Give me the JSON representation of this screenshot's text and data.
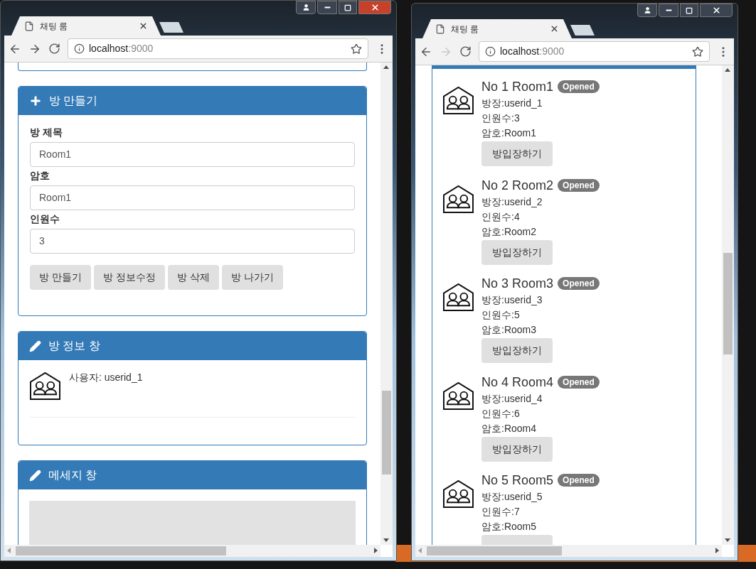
{
  "windows": [
    {
      "tab_title": "채팅 룸",
      "url_host": "localhost",
      "url_port": ":9000",
      "forward_enabled": true,
      "create_panel": {
        "title": "방 만들기",
        "fields": [
          {
            "label": "방 제목",
            "value": "Room1"
          },
          {
            "label": "암호",
            "value": "Room1"
          },
          {
            "label": "인원수",
            "value": "3"
          }
        ],
        "buttons": [
          "방 만들기",
          "방 정보수정",
          "방 삭제",
          "방 나가기"
        ]
      },
      "info_panel": {
        "title": "방 정보 창",
        "user": "사용자: userid_1"
      },
      "message_panel": {
        "title": "메세지 창"
      }
    },
    {
      "tab_title": "채팅 룸",
      "url_host": "localhost",
      "url_port": ":9000",
      "forward_enabled": false,
      "rooms": [
        {
          "title": "No 1 Room1",
          "status": "Opened",
          "owner": "방장:userid_1",
          "members": "인원수:3",
          "password": "암호:Room1",
          "button": "방입장하기"
        },
        {
          "title": "No 2 Room2",
          "status": "Opened",
          "owner": "방장:userid_2",
          "members": "인원수:4",
          "password": "암호:Room2",
          "button": "방입장하기"
        },
        {
          "title": "No 3 Room3",
          "status": "Opened",
          "owner": "방장:userid_3",
          "members": "인원수:5",
          "password": "암호:Room3",
          "button": "방입장하기"
        },
        {
          "title": "No 4 Room4",
          "status": "Opened",
          "owner": "방장:userid_4",
          "members": "인원수:6",
          "password": "암호:Room4",
          "button": "방입장하기"
        },
        {
          "title": "No 5 Room5",
          "status": "Opened",
          "owner": "방장:userid_5",
          "members": "인원수:7",
          "password": "암호:Room5"
        }
      ]
    }
  ]
}
